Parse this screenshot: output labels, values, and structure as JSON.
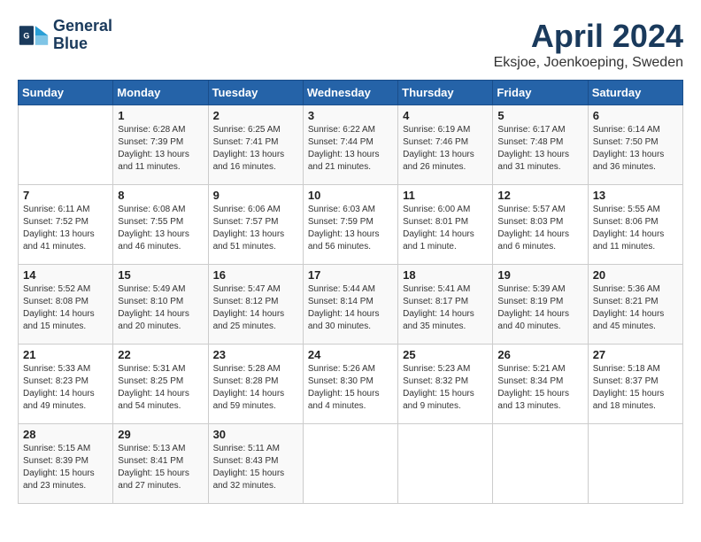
{
  "header": {
    "logo_line1": "General",
    "logo_line2": "Blue",
    "month_title": "April 2024",
    "location": "Eksjoe, Joenkoeping, Sweden"
  },
  "days_of_week": [
    "Sunday",
    "Monday",
    "Tuesday",
    "Wednesday",
    "Thursday",
    "Friday",
    "Saturday"
  ],
  "weeks": [
    [
      {
        "day": "",
        "info": ""
      },
      {
        "day": "1",
        "info": "Sunrise: 6:28 AM\nSunset: 7:39 PM\nDaylight: 13 hours\nand 11 minutes."
      },
      {
        "day": "2",
        "info": "Sunrise: 6:25 AM\nSunset: 7:41 PM\nDaylight: 13 hours\nand 16 minutes."
      },
      {
        "day": "3",
        "info": "Sunrise: 6:22 AM\nSunset: 7:44 PM\nDaylight: 13 hours\nand 21 minutes."
      },
      {
        "day": "4",
        "info": "Sunrise: 6:19 AM\nSunset: 7:46 PM\nDaylight: 13 hours\nand 26 minutes."
      },
      {
        "day": "5",
        "info": "Sunrise: 6:17 AM\nSunset: 7:48 PM\nDaylight: 13 hours\nand 31 minutes."
      },
      {
        "day": "6",
        "info": "Sunrise: 6:14 AM\nSunset: 7:50 PM\nDaylight: 13 hours\nand 36 minutes."
      }
    ],
    [
      {
        "day": "7",
        "info": "Sunrise: 6:11 AM\nSunset: 7:52 PM\nDaylight: 13 hours\nand 41 minutes."
      },
      {
        "day": "8",
        "info": "Sunrise: 6:08 AM\nSunset: 7:55 PM\nDaylight: 13 hours\nand 46 minutes."
      },
      {
        "day": "9",
        "info": "Sunrise: 6:06 AM\nSunset: 7:57 PM\nDaylight: 13 hours\nand 51 minutes."
      },
      {
        "day": "10",
        "info": "Sunrise: 6:03 AM\nSunset: 7:59 PM\nDaylight: 13 hours\nand 56 minutes."
      },
      {
        "day": "11",
        "info": "Sunrise: 6:00 AM\nSunset: 8:01 PM\nDaylight: 14 hours\nand 1 minute."
      },
      {
        "day": "12",
        "info": "Sunrise: 5:57 AM\nSunset: 8:03 PM\nDaylight: 14 hours\nand 6 minutes."
      },
      {
        "day": "13",
        "info": "Sunrise: 5:55 AM\nSunset: 8:06 PM\nDaylight: 14 hours\nand 11 minutes."
      }
    ],
    [
      {
        "day": "14",
        "info": "Sunrise: 5:52 AM\nSunset: 8:08 PM\nDaylight: 14 hours\nand 15 minutes."
      },
      {
        "day": "15",
        "info": "Sunrise: 5:49 AM\nSunset: 8:10 PM\nDaylight: 14 hours\nand 20 minutes."
      },
      {
        "day": "16",
        "info": "Sunrise: 5:47 AM\nSunset: 8:12 PM\nDaylight: 14 hours\nand 25 minutes."
      },
      {
        "day": "17",
        "info": "Sunrise: 5:44 AM\nSunset: 8:14 PM\nDaylight: 14 hours\nand 30 minutes."
      },
      {
        "day": "18",
        "info": "Sunrise: 5:41 AM\nSunset: 8:17 PM\nDaylight: 14 hours\nand 35 minutes."
      },
      {
        "day": "19",
        "info": "Sunrise: 5:39 AM\nSunset: 8:19 PM\nDaylight: 14 hours\nand 40 minutes."
      },
      {
        "day": "20",
        "info": "Sunrise: 5:36 AM\nSunset: 8:21 PM\nDaylight: 14 hours\nand 45 minutes."
      }
    ],
    [
      {
        "day": "21",
        "info": "Sunrise: 5:33 AM\nSunset: 8:23 PM\nDaylight: 14 hours\nand 49 minutes."
      },
      {
        "day": "22",
        "info": "Sunrise: 5:31 AM\nSunset: 8:25 PM\nDaylight: 14 hours\nand 54 minutes."
      },
      {
        "day": "23",
        "info": "Sunrise: 5:28 AM\nSunset: 8:28 PM\nDaylight: 14 hours\nand 59 minutes."
      },
      {
        "day": "24",
        "info": "Sunrise: 5:26 AM\nSunset: 8:30 PM\nDaylight: 15 hours\nand 4 minutes."
      },
      {
        "day": "25",
        "info": "Sunrise: 5:23 AM\nSunset: 8:32 PM\nDaylight: 15 hours\nand 9 minutes."
      },
      {
        "day": "26",
        "info": "Sunrise: 5:21 AM\nSunset: 8:34 PM\nDaylight: 15 hours\nand 13 minutes."
      },
      {
        "day": "27",
        "info": "Sunrise: 5:18 AM\nSunset: 8:37 PM\nDaylight: 15 hours\nand 18 minutes."
      }
    ],
    [
      {
        "day": "28",
        "info": "Sunrise: 5:15 AM\nSunset: 8:39 PM\nDaylight: 15 hours\nand 23 minutes."
      },
      {
        "day": "29",
        "info": "Sunrise: 5:13 AM\nSunset: 8:41 PM\nDaylight: 15 hours\nand 27 minutes."
      },
      {
        "day": "30",
        "info": "Sunrise: 5:11 AM\nSunset: 8:43 PM\nDaylight: 15 hours\nand 32 minutes."
      },
      {
        "day": "",
        "info": ""
      },
      {
        "day": "",
        "info": ""
      },
      {
        "day": "",
        "info": ""
      },
      {
        "day": "",
        "info": ""
      }
    ]
  ]
}
